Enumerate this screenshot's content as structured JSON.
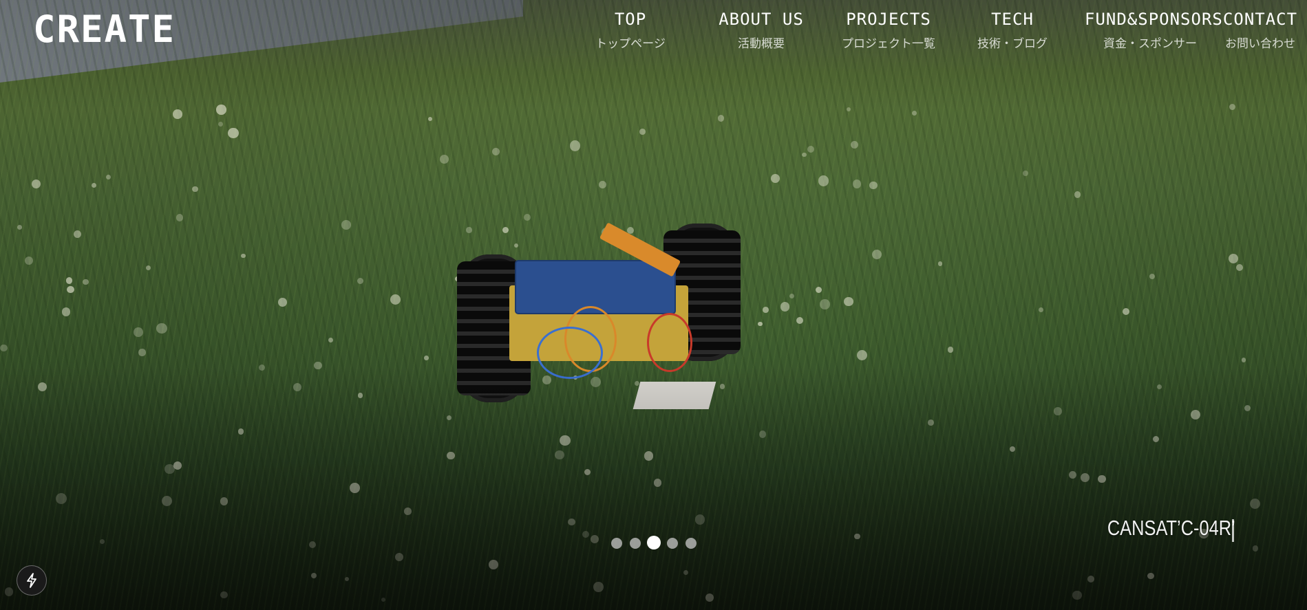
{
  "header": {
    "logo_text": "CREATE"
  },
  "nav": [
    {
      "en": "TOP",
      "jp": "トップページ"
    },
    {
      "en": "ABOUT US",
      "jp": "活動概要"
    },
    {
      "en": "PROJECTS",
      "jp": "プロジェクト一覧"
    },
    {
      "en": "TECH",
      "jp": "技術・ブログ"
    },
    {
      "en": "FUND&SPONSORS",
      "jp": "資金・スポンサー"
    },
    {
      "en": "CONTACT",
      "jp": "お問い合わせ"
    }
  ],
  "slider": {
    "caption": "CANSAT’C-04R’",
    "dot_count": 5,
    "active_index": 2
  },
  "floating_button": {
    "icon": "lightning-icon"
  },
  "colors": {
    "text": "#ffffff",
    "dot_inactive": "#c8c8c8",
    "dot_active": "#ffffff"
  }
}
